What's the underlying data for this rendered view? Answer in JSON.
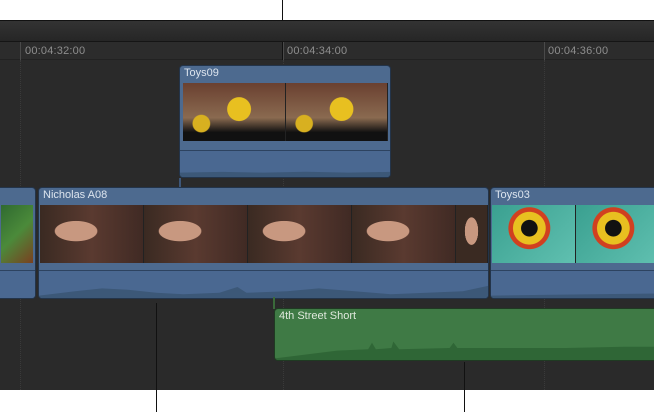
{
  "ruler": {
    "timecodes": [
      "00:04:32:00",
      "00:04:34:00",
      "00:04:36:00"
    ]
  },
  "clips": {
    "connected_video": {
      "name": "Toys09"
    },
    "primary_prev": {
      "name": ""
    },
    "primary_main": {
      "name": "Nicholas A08"
    },
    "primary_next": {
      "name": "Toys03"
    },
    "connected_audio": {
      "name": "4th Street Short"
    }
  },
  "colors": {
    "video_clip": "#4d6a8f",
    "audio_clip": "#3f7a45",
    "timeline_bg": "#2a2a2a"
  }
}
